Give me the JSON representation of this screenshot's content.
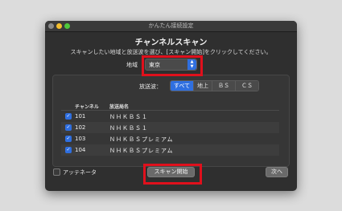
{
  "window": {
    "title": "かんたん接続設定"
  },
  "dialog": {
    "heading": "チャンネルスキャン",
    "instruction": "スキャンしたい地域と放送波を選び、[スキャン開始]をクリックしてください。"
  },
  "region": {
    "label": "地域",
    "value": "東京"
  },
  "broadcast": {
    "label": "放送波：",
    "options": [
      "すべて",
      "地上",
      "ＢＳ",
      "ＣＳ"
    ],
    "selected": "すべて"
  },
  "table": {
    "headers": [
      "チャンネル",
      "放送局名"
    ],
    "rows": [
      {
        "checked": true,
        "channel": "101",
        "name": "ＮＨＫＢＳ１"
      },
      {
        "checked": true,
        "channel": "102",
        "name": "ＮＨＫＢＳ１"
      },
      {
        "checked": true,
        "channel": "103",
        "name": "ＮＨＫＢＳプレミアム"
      },
      {
        "checked": true,
        "channel": "104",
        "name": "ＮＨＫＢＳプレミアム"
      }
    ]
  },
  "antenna": {
    "label": "アッテネータ",
    "checked": false
  },
  "buttons": {
    "scan": "スキャン開始",
    "next": "次へ"
  },
  "colors": {
    "accent": "#2f6fe0",
    "highlight": "#e0101c",
    "window_bg": "#2f2f2f"
  }
}
